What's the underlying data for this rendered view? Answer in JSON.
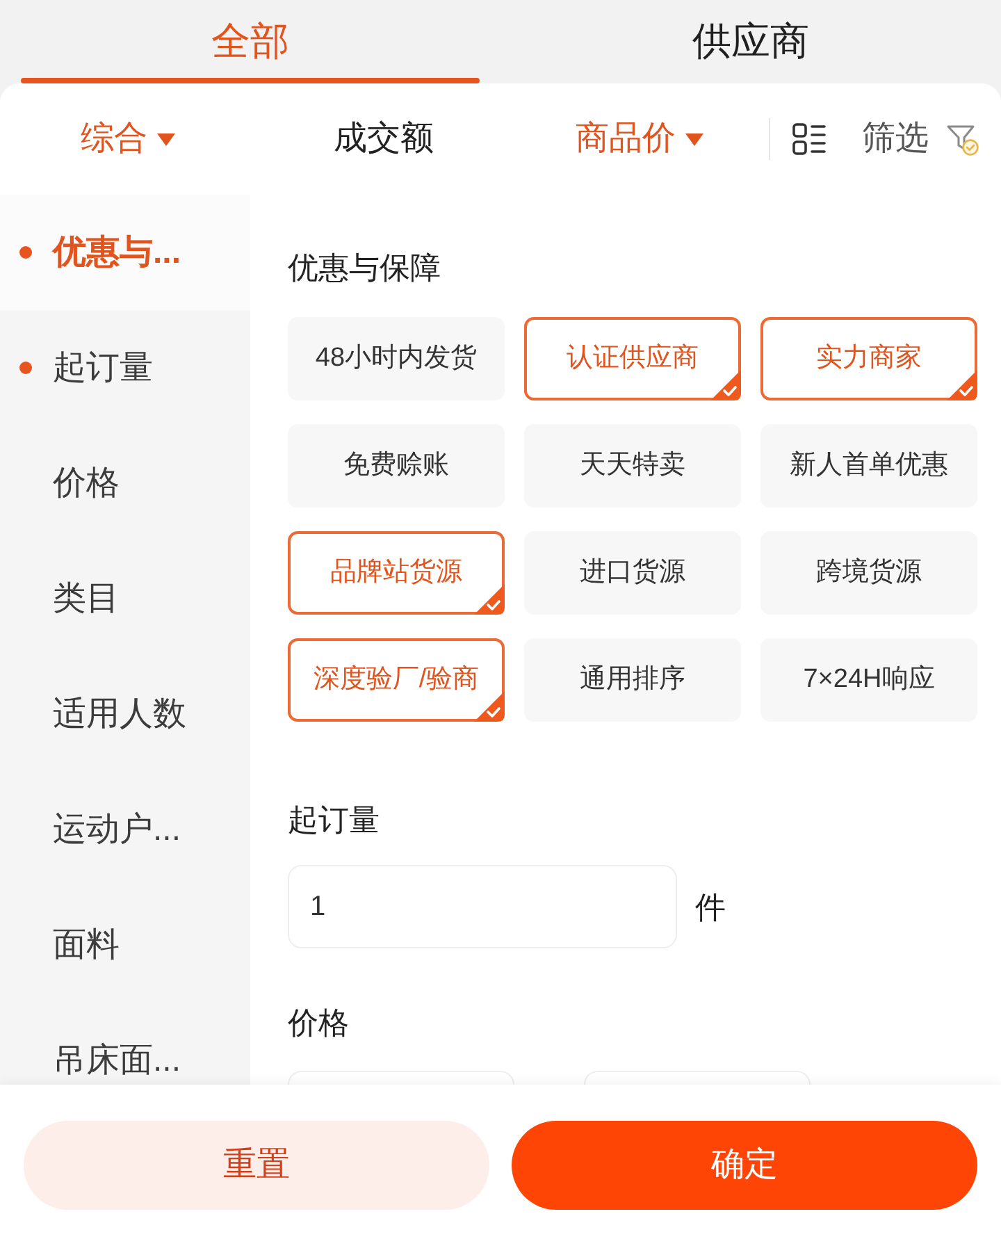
{
  "tabs": [
    {
      "label": "全部",
      "selected": true
    },
    {
      "label": "供应商",
      "selected": false
    }
  ],
  "sort_bar": {
    "options": [
      {
        "label": "综合",
        "kind": "dropdown",
        "highlighted": true
      },
      {
        "label": "成交额",
        "kind": "plain",
        "highlighted": false
      },
      {
        "label": "商品价",
        "kind": "dropdown",
        "highlighted": true
      }
    ],
    "filter_label": "筛选"
  },
  "sidebar": {
    "items": [
      {
        "label": "优惠与...",
        "selected": true,
        "marked": true
      },
      {
        "label": "起订量",
        "selected": false,
        "marked": true
      },
      {
        "label": "价格",
        "selected": false,
        "marked": false
      },
      {
        "label": "类目",
        "selected": false,
        "marked": false
      },
      {
        "label": "适用人数",
        "selected": false,
        "marked": false
      },
      {
        "label": "运动户...",
        "selected": false,
        "marked": false
      },
      {
        "label": "面料",
        "selected": false,
        "marked": false
      },
      {
        "label": "吊床面...",
        "selected": false,
        "marked": false
      }
    ]
  },
  "benefits": {
    "title": "优惠与保障",
    "options": [
      {
        "label": "48小时内发货",
        "selected": false
      },
      {
        "label": "认证供应商",
        "selected": true
      },
      {
        "label": "实力商家",
        "selected": true
      },
      {
        "label": "免费赊账",
        "selected": false
      },
      {
        "label": "天天特卖",
        "selected": false
      },
      {
        "label": "新人首单优惠",
        "selected": false
      },
      {
        "label": "品牌站货源",
        "selected": true
      },
      {
        "label": "进口货源",
        "selected": false
      },
      {
        "label": "跨境货源",
        "selected": false
      },
      {
        "label": "深度验厂/验商",
        "selected": true
      },
      {
        "label": "通用排序",
        "selected": false
      },
      {
        "label": "7×24H响应",
        "selected": false
      }
    ]
  },
  "min_order": {
    "title": "起订量",
    "value": "1",
    "unit": "件"
  },
  "price": {
    "title": "价格"
  },
  "buttons": [
    {
      "label": "重置",
      "kind": "secondary"
    },
    {
      "label": "确定",
      "kind": "primary"
    }
  ]
}
